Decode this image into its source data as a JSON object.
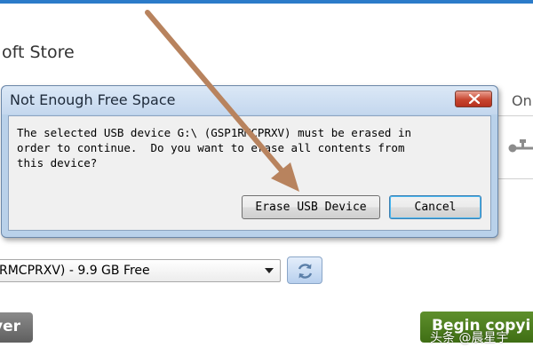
{
  "app": {
    "title_fragment": "oft Store",
    "right_text_fragment": "Onl"
  },
  "dialog": {
    "title": "Not Enough Free Space",
    "message": "The selected USB device G:\\ (GSP1RMCPRXV) must be erased in\norder to continue.  Do you want to erase all contents from\nthis device?",
    "erase_label": "Erase USB Device",
    "cancel_label": "Cancel"
  },
  "drive_select": {
    "value": "RMCPRXV) - 9.9 GB Free"
  },
  "bottom": {
    "back_label": "ver",
    "begin_label": "Begin copyi"
  },
  "watermark": "头条 @晨星宇",
  "colors": {
    "dialog_frame": "#b9d1ea",
    "close_red": "#c7452f",
    "begin_green": "#4f7f1f",
    "arrow": "#b8835e",
    "top_strip": "#2b7bc9"
  },
  "icons": [
    "close-icon",
    "usb-icon",
    "dropdown-arrow-icon",
    "refresh-icon"
  ]
}
